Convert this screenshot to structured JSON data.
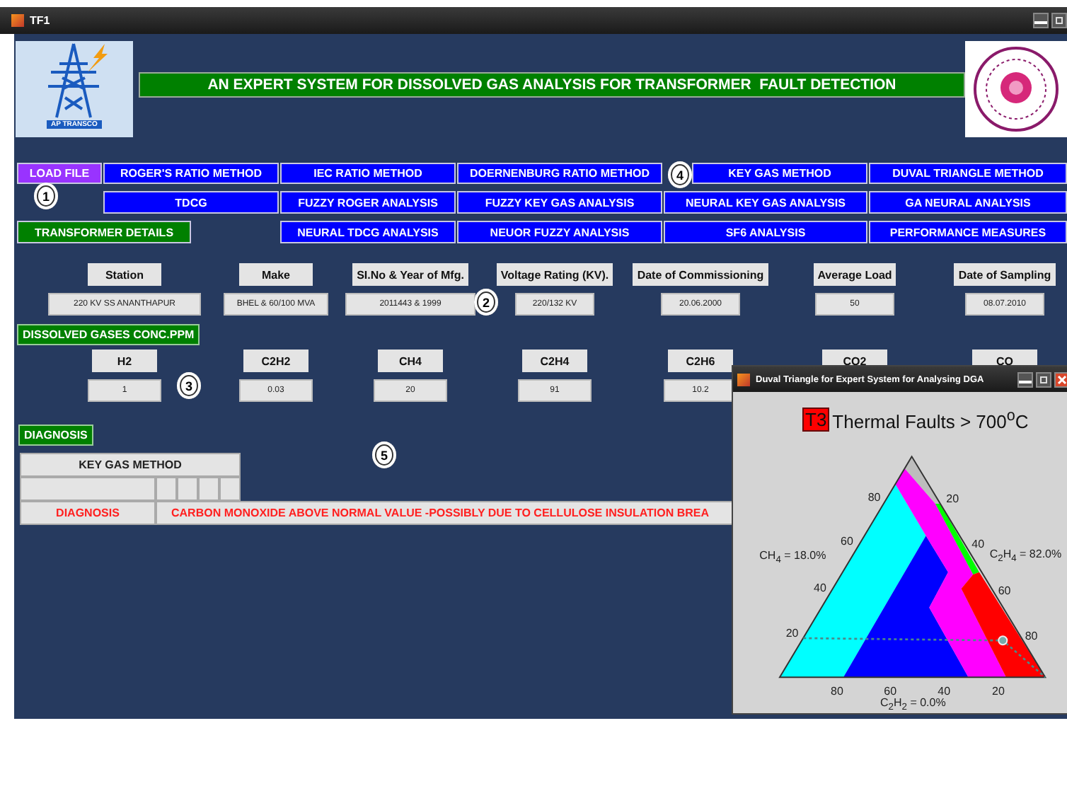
{
  "window": {
    "title": "TF1"
  },
  "header": {
    "logo_text": "AP TRANSCO",
    "title": "AN EXPERT SYSTEM FOR DISSOLVED GAS ANALYSIS FOR TRANSFORMER  FAULT DETECTION"
  },
  "button_rows": [
    [
      {
        "label": "LOAD FILE",
        "kind": "load"
      },
      {
        "label": "ROGER'S RATIO METHOD",
        "kind": "method"
      },
      {
        "label": "IEC RATIO METHOD",
        "kind": "method"
      },
      {
        "label": "DOERNENBURG RATIO METHOD",
        "kind": "method"
      },
      {
        "label": "KEY GAS METHOD",
        "kind": "method"
      },
      {
        "label": "DUVAL TRIANGLE METHOD",
        "kind": "method"
      }
    ],
    [
      {
        "label": "TDCG",
        "kind": "method"
      },
      {
        "label": "FUZZY ROGER ANALYSIS",
        "kind": "method"
      },
      {
        "label": "FUZZY KEY GAS ANALYSIS",
        "kind": "method"
      },
      {
        "label": "NEURAL KEY GAS ANALYSIS",
        "kind": "method"
      },
      {
        "label": "GA NEURAL ANALYSIS",
        "kind": "method"
      }
    ],
    [
      {
        "label": "TRANSFORMER DETAILS",
        "kind": "section"
      },
      {
        "label": "NEURAL TDCG ANALYSIS",
        "kind": "method"
      },
      {
        "label": "NEUOR FUZZY  ANALYSIS",
        "kind": "method"
      },
      {
        "label": "SF6 ANALYSIS",
        "kind": "method"
      },
      {
        "label": "PERFORMANCE MEASURES",
        "kind": "method"
      }
    ]
  ],
  "markers": [
    "1",
    "4",
    "2",
    "3",
    "5"
  ],
  "transformer_details": [
    {
      "label": "Station",
      "value": "220 KV SS ANANTHAPUR"
    },
    {
      "label": "Make",
      "value": "BHEL & 60/100 MVA"
    },
    {
      "label": "SI.No & Year of Mfg.",
      "value": "2011443 & 1999"
    },
    {
      "label": "Voltage Rating (KV).",
      "value": "220/132 KV"
    },
    {
      "label": "Date of Commissioning",
      "value": "20.06.2000"
    },
    {
      "label": "Average Load",
      "value": "50"
    },
    {
      "label": "Date of Sampling",
      "value": "08.07.2010"
    }
  ],
  "gases": {
    "title": "DISSOLVED GASES CONC.PPM",
    "items": [
      {
        "label": "H2",
        "value": "1"
      },
      {
        "label": "C2H2",
        "value": "0.03"
      },
      {
        "label": "CH4",
        "value": "20"
      },
      {
        "label": "C2H4",
        "value": "91"
      },
      {
        "label": "C2H6",
        "value": "10.2"
      },
      {
        "label": "CO2"
      },
      {
        "label": "CO"
      }
    ]
  },
  "diagnosis": {
    "title": "DIAGNOSIS",
    "table_header": "KEY GAS METHOD",
    "row_label": "DIAGNOSIS",
    "result": "CARBON MONOXIDE ABOVE NORMAL VALUE -POSSIBLY DUE TO CELLULOSE INSULATION BREA"
  },
  "duval_window": {
    "title": "Duval Triangle for Expert System for Analysing DGA",
    "zone": "T3",
    "heading": "Thermal Faults > 700$^{o}$C",
    "left_ticks": [
      "80",
      "60",
      "40",
      "20"
    ],
    "right_ticks": [
      "20",
      "40",
      "60",
      "80"
    ],
    "bottom_ticks": [
      "80",
      "60",
      "40",
      "20"
    ],
    "ch4_label": "CH$_{4}$ = 18.0%",
    "c2h4_label": "C$_{2}$H$_{4}$ = 82.0%",
    "c2h2_label": "C$_{2}$H$_{2}$ = 0.0%"
  }
}
